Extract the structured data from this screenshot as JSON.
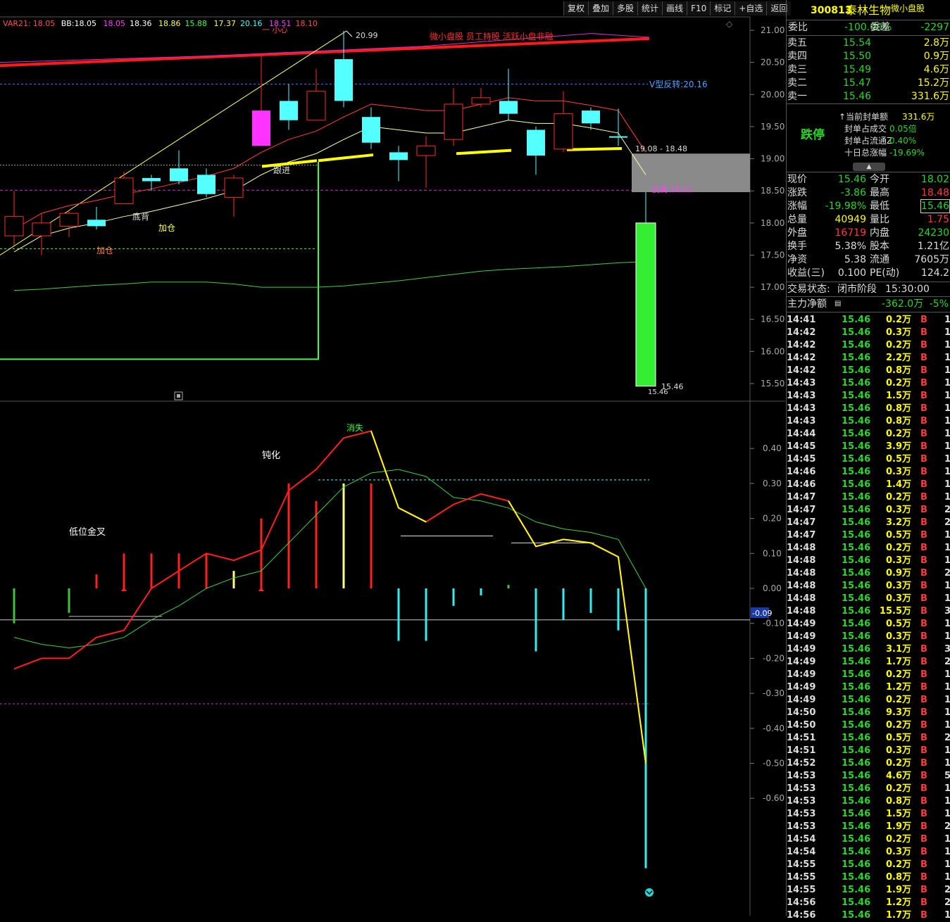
{
  "colors": {
    "up": "#ff2a2a",
    "down": "#54ffff",
    "ma_yellow": "#ffff60",
    "bb_mid": "#ff2020",
    "bb_up": "#cc33cc",
    "grid": "#444444"
  },
  "toolbar": [
    "复权",
    "叠加",
    "多股",
    "统计",
    "画线",
    "F10",
    "标记",
    "+自选",
    "返回"
  ],
  "indicator": {
    "name": "VAR21:",
    "v1": "18.05",
    "bb_label": "BB:",
    "bb1": "18.05",
    "bb2": "18.05",
    "bb3": "18.36",
    "bb4": "18.86",
    "bb5": "15.88",
    "bb6": "17.37",
    "bb7": "20.16",
    "bb8": "18.51",
    "bb9": "18.10"
  },
  "price_axis": [
    "21.00",
    "20.50",
    "20.00",
    "19.50",
    "19.00",
    "18.50",
    "18.00",
    "17.50",
    "17.00",
    "16.50",
    "16.00",
    "15.50"
  ],
  "sub_axis": [
    "0.40",
    "0.30",
    "0.20",
    "0.10",
    "0.00",
    "-0.10",
    "-0.20",
    "-0.30",
    "-0.40",
    "-0.50",
    "-0.60"
  ],
  "sub_current": "-0.09",
  "annotations": {
    "banner": "微小盘股 员工持股 活跃小盘非融",
    "top": "一 小心",
    "high": "20.99",
    "v_reversal": "V型反转:20.16",
    "range": "19.08 - 18.48",
    "fanzhuan": "反属:18.51",
    "low": "15.46",
    "low2": "15.46",
    "gen_jin": "跟进",
    "di_bei": "底背",
    "jia_cang": "加仓",
    "jia_cang2": "加仓",
    "dun_hua": "钝化",
    "xiao_shi": "消失",
    "di_wei": "低位金叉"
  },
  "candles": [
    {
      "o": 17.8,
      "c": 18.1,
      "h": 18.5,
      "l": 17.65
    },
    {
      "o": 17.8,
      "c": 18.0,
      "h": 18.15,
      "l": 17.5
    },
    {
      "o": 17.95,
      "c": 18.15,
      "h": 18.2,
      "l": 17.78
    },
    {
      "o": 18.05,
      "c": 17.95,
      "h": 18.25,
      "l": 17.9
    },
    {
      "o": 18.3,
      "c": 18.7,
      "h": 18.8,
      "l": 18.3
    },
    {
      "o": 18.7,
      "c": 18.65,
      "h": 18.75,
      "l": 18.5
    },
    {
      "o": 18.85,
      "c": 18.65,
      "h": 19.13,
      "l": 18.6
    },
    {
      "o": 18.75,
      "c": 18.45,
      "h": 18.85,
      "l": 18.4
    },
    {
      "o": 18.4,
      "c": 18.7,
      "h": 18.75,
      "l": 18.1
    },
    {
      "o": 19.2,
      "c": 19.75,
      "h": 20.6,
      "l": 19.2
    },
    {
      "o": 19.9,
      "c": 19.6,
      "h": 20.16,
      "l": 19.45
    },
    {
      "o": 19.6,
      "c": 20.05,
      "h": 20.4,
      "l": 19.6
    },
    {
      "o": 20.55,
      "c": 19.9,
      "h": 20.99,
      "l": 19.8
    },
    {
      "o": 19.65,
      "c": 19.25,
      "h": 19.8,
      "l": 19.15
    },
    {
      "o": 19.1,
      "c": 18.98,
      "h": 19.2,
      "l": 18.65
    },
    {
      "o": 19.05,
      "c": 19.2,
      "h": 19.35,
      "l": 18.55
    },
    {
      "o": 19.3,
      "c": 19.85,
      "h": 20.1,
      "l": 19.2
    },
    {
      "o": 19.85,
      "c": 19.95,
      "h": 20.1,
      "l": 19.8
    },
    {
      "o": 19.9,
      "c": 19.7,
      "h": 20.4,
      "l": 19.6
    },
    {
      "o": 19.45,
      "c": 19.05,
      "h": 19.5,
      "l": 18.75
    },
    {
      "o": 19.15,
      "c": 19.7,
      "h": 20.05,
      "l": 19.1
    },
    {
      "o": 19.75,
      "c": 19.55,
      "h": 19.8,
      "l": 19.45
    },
    {
      "o": 19.35,
      "c": 19.33,
      "h": 19.78,
      "l": 19.2
    },
    {
      "o": 18.0,
      "c": 15.46,
      "h": 18.48,
      "l": 15.46
    }
  ],
  "ma_line": [
    17.55,
    17.8,
    17.92,
    18.0,
    18.1,
    18.18,
    18.28,
    18.38,
    18.5,
    18.75,
    18.95,
    19.08,
    19.3,
    19.5,
    19.45,
    19.4,
    19.4,
    19.5,
    19.6,
    19.55,
    19.55,
    19.48,
    19.4,
    18.75
  ],
  "ma_long": [
    16.95,
    16.97,
    17.0,
    17.03,
    17.05,
    17.08,
    17.08,
    17.08,
    17.05,
    17.0,
    17.0,
    17.0,
    17.02,
    17.06,
    17.1,
    17.15,
    17.2,
    17.25,
    17.28,
    17.3,
    17.32,
    17.35,
    17.38,
    17.4
  ],
  "sub_red": [
    -0.23,
    -0.2,
    -0.2,
    -0.14,
    -0.12,
    0.0,
    0.05,
    0.1,
    0.08,
    0.11,
    0.28,
    0.34,
    0.43,
    0.45,
    0.23,
    0.19,
    0.24,
    0.27,
    0.25,
    0.12,
    0.14,
    0.13,
    0.09,
    -0.5
  ],
  "sub_green": [
    -0.14,
    -0.16,
    -0.17,
    -0.16,
    -0.14,
    -0.09,
    -0.05,
    0.0,
    0.03,
    0.05,
    0.13,
    0.21,
    0.29,
    0.33,
    0.34,
    0.32,
    0.26,
    0.25,
    0.23,
    0.19,
    0.17,
    0.16,
    0.14,
    0.0
  ],
  "sub_bars": [
    -0.1,
    0.0,
    -0.07,
    0.04,
    0.1,
    0.1,
    0.1,
    0.1,
    0.05,
    0.2,
    0.3,
    0.25,
    0.3,
    0.3,
    -0.15,
    -0.15,
    -0.05,
    -0.02,
    0.01,
    -0.18,
    -0.09,
    -0.07,
    -0.12,
    -0.8
  ],
  "quote": {
    "code": "300813",
    "name": "泰林生物",
    "tag": "微小盘股",
    "webi_label": "委比",
    "webi": "-100.00%",
    "wecha_label": "委差",
    "wecha": "-2297",
    "asks": [
      {
        "l": "卖五",
        "p": "15.54",
        "v": "2.8万"
      },
      {
        "l": "卖四",
        "p": "15.50",
        "v": "0.9万"
      },
      {
        "l": "卖三",
        "p": "15.49",
        "v": "4.6万"
      },
      {
        "l": "卖二",
        "p": "15.47",
        "v": "15.2万"
      },
      {
        "l": "卖一",
        "p": "15.46",
        "v": "331.6万"
      }
    ],
    "limit_label": "跌停",
    "limit_info": [
      {
        "k": "当前封单额",
        "v": "331.6万"
      },
      {
        "k": "封单占成交",
        "v": "0.05倍"
      },
      {
        "k": "封单占流通Z",
        "v": "0.40%"
      },
      {
        "k": "十日总涨幅",
        "v": "-19.69%"
      }
    ],
    "stats": [
      {
        "l1": "现价",
        "v1": "15.46",
        "l2": "今开",
        "v2": "18.02"
      },
      {
        "l1": "涨跌",
        "v1": "-3.86",
        "l2": "最高",
        "v2": "18.48"
      },
      {
        "l1": "涨幅",
        "v1": "-19.98%",
        "l2": "最低",
        "v2": "15.46"
      },
      {
        "l1": "总量",
        "v1": "40949",
        "l2": "量比",
        "v2": "1.75"
      },
      {
        "l1": "外盘",
        "v1": "16719",
        "l2": "内盘",
        "v2": "24230"
      },
      {
        "l1": "换手",
        "v1": "5.38%",
        "l2": "股本",
        "v2": "1.21亿"
      },
      {
        "l1": "净资",
        "v1": "5.38",
        "l2": "流通",
        "v2": "7605万"
      },
      {
        "l1": "收益(三)",
        "v1": "0.100",
        "l2": "PE(动)",
        "v2": "124.2"
      }
    ],
    "trade_status_label": "交易状态:",
    "trade_status": "闭市阶段",
    "trade_time": "15:30:00",
    "main_flow_label": "主力净额",
    "main_flow": "-362.0万",
    "main_flow_pct": "-5%"
  },
  "ticks": [
    [
      "14:41",
      "15.46",
      "0.2万",
      "B",
      "1"
    ],
    [
      "14:42",
      "15.46",
      "0.3万",
      "B",
      "1"
    ],
    [
      "14:42",
      "15.46",
      "0.2万",
      "B",
      "1"
    ],
    [
      "14:42",
      "15.46",
      "2.2万",
      "B",
      "1"
    ],
    [
      "14:42",
      "15.46",
      "0.8万",
      "B",
      "1"
    ],
    [
      "14:43",
      "15.46",
      "0.2万",
      "B",
      "1"
    ],
    [
      "14:43",
      "15.46",
      "1.5万",
      "B",
      "1"
    ],
    [
      "14:43",
      "15.46",
      "0.8万",
      "B",
      "1"
    ],
    [
      "14:43",
      "15.46",
      "0.8万",
      "B",
      "1"
    ],
    [
      "14:44",
      "15.46",
      "0.2万",
      "B",
      "1"
    ],
    [
      "14:45",
      "15.46",
      "3.9万",
      "B",
      "1"
    ],
    [
      "14:45",
      "15.46",
      "0.5万",
      "B",
      "1"
    ],
    [
      "14:46",
      "15.46",
      "0.3万",
      "B",
      "1"
    ],
    [
      "14:46",
      "15.46",
      "1.4万",
      "B",
      "1"
    ],
    [
      "14:47",
      "15.46",
      "0.2万",
      "B",
      "1"
    ],
    [
      "14:47",
      "15.46",
      "0.3万",
      "B",
      "2"
    ],
    [
      "14:47",
      "15.46",
      "3.2万",
      "B",
      "2"
    ],
    [
      "14:47",
      "15.46",
      "0.5万",
      "B",
      "1"
    ],
    [
      "14:48",
      "15.46",
      "0.2万",
      "B",
      "1"
    ],
    [
      "14:48",
      "15.46",
      "0.3万",
      "B",
      "1"
    ],
    [
      "14:48",
      "15.46",
      "0.9万",
      "B",
      "2"
    ],
    [
      "14:48",
      "15.46",
      "0.3万",
      "B",
      "1"
    ],
    [
      "14:48",
      "15.46",
      "0.3万",
      "B",
      "1"
    ],
    [
      "14:48",
      "15.46",
      "15.5万",
      "B",
      "3"
    ],
    [
      "14:49",
      "15.46",
      "0.5万",
      "B",
      "1"
    ],
    [
      "14:49",
      "15.46",
      "0.3万",
      "B",
      "1"
    ],
    [
      "14:49",
      "15.46",
      "3.1万",
      "B",
      "3"
    ],
    [
      "14:49",
      "15.46",
      "1.7万",
      "B",
      "2"
    ],
    [
      "14:49",
      "15.46",
      "0.2万",
      "B",
      "1"
    ],
    [
      "14:49",
      "15.46",
      "1.2万",
      "B",
      "1"
    ],
    [
      "14:49",
      "15.46",
      "0.2万",
      "B",
      "1"
    ],
    [
      "14:50",
      "15.46",
      "9.3万",
      "B",
      "1"
    ],
    [
      "14:50",
      "15.46",
      "0.2万",
      "B",
      "1"
    ],
    [
      "14:51",
      "15.46",
      "0.5万",
      "B",
      "2"
    ],
    [
      "14:51",
      "15.46",
      "0.3万",
      "B",
      "1"
    ],
    [
      "14:52",
      "15.46",
      "0.2万",
      "B",
      "1"
    ],
    [
      "14:53",
      "15.46",
      "4.6万",
      "B",
      "5"
    ],
    [
      "14:53",
      "15.46",
      "0.2万",
      "B",
      "1"
    ],
    [
      "14:53",
      "15.46",
      "0.8万",
      "B",
      "1"
    ],
    [
      "14:53",
      "15.46",
      "1.5万",
      "B",
      "1"
    ],
    [
      "14:53",
      "15.46",
      "1.9万",
      "B",
      "2"
    ],
    [
      "14:54",
      "15.46",
      "0.2万",
      "B",
      "1"
    ],
    [
      "14:54",
      "15.46",
      "0.3万",
      "B",
      "1"
    ],
    [
      "14:55",
      "15.46",
      "0.2万",
      "B",
      "1"
    ],
    [
      "14:55",
      "15.46",
      "0.8万",
      "B",
      "1"
    ],
    [
      "14:55",
      "15.46",
      "1.9万",
      "B",
      "2"
    ],
    [
      "14:56",
      "15.46",
      "1.2万",
      "B",
      "2"
    ],
    [
      "14:56",
      "15.46",
      "1.7万",
      "B",
      "1"
    ]
  ]
}
